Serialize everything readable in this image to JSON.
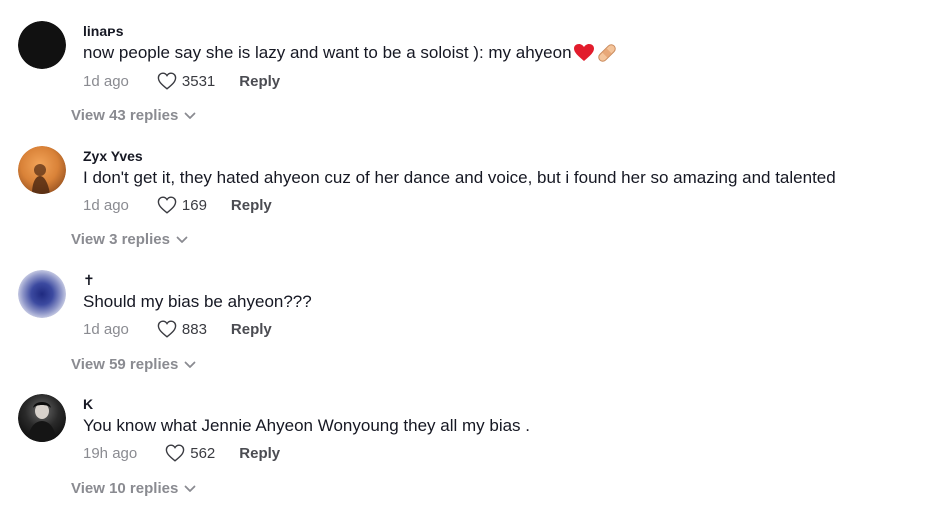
{
  "comments": [
    {
      "username": "linaᴘs",
      "text": "now people say she is lazy and want to be a soloist ): my ahyeon",
      "emojis": [
        "red-heart",
        "adhesive-bandage"
      ],
      "date": "1d ago",
      "likes": "3531",
      "reply_label": "Reply",
      "view_replies": "View 43 replies"
    },
    {
      "username": "Zyx Yves",
      "text": "I don't get it, they hated ahyeon cuz of her dance and voice, but i found her so amazing and talented",
      "date": "1d ago",
      "likes": "169",
      "reply_label": "Reply",
      "view_replies": "View 3 replies"
    },
    {
      "username": "✝",
      "text": "Should my bias be ahyeon???",
      "date": "1d ago",
      "likes": "883",
      "reply_label": "Reply",
      "view_replies": "View 59 replies"
    },
    {
      "username": "K",
      "text": "You know what Jennie Ahyeon Wonyoung they all my bias .",
      "date": "19h ago",
      "likes": "562",
      "reply_label": "Reply",
      "view_replies": "View 10 replies"
    }
  ],
  "colors": {
    "text": "#161823",
    "muted": "#8a8b91",
    "reply": "#4b4c52"
  },
  "icons": {
    "like": "heart-outline-icon",
    "expand": "chevron-down-icon"
  }
}
